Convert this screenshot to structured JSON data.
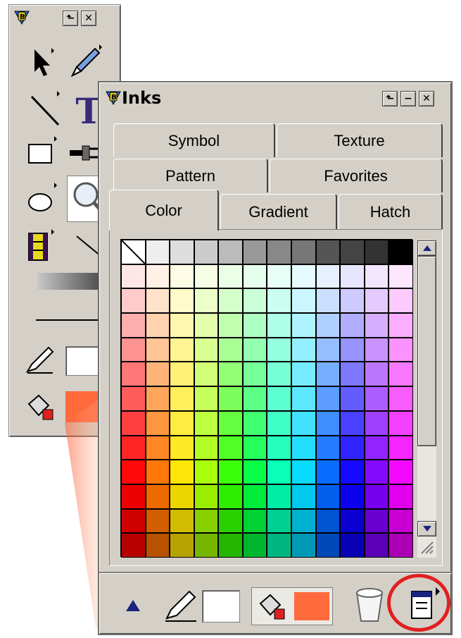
{
  "inks_panel": {
    "title": "Inks",
    "tabs_row1": [
      "Symbol",
      "Texture"
    ],
    "tabs_row2": [
      "Pattern",
      "Favorites"
    ],
    "tabs_row3": [
      "Color",
      "Gradient",
      "Hatch"
    ],
    "active_tab": "Color",
    "title_buttons": [
      "dock-icon",
      "minimize-icon",
      "close-icon"
    ],
    "stroke_color": "#ffffff",
    "fill_color": "#ff6a3d",
    "bottom_icons": [
      "collapse-triangle-icon",
      "pen-stroke-icon",
      "paint-bucket-fill-icon",
      "trash-icon",
      "panel-menu-icon"
    ]
  },
  "toolbox": {
    "title_buttons": [
      "dock-icon",
      "close-icon"
    ],
    "tools": [
      "arrow-tool-icon",
      "pen-tool-icon",
      "line-tool-icon",
      "text-tool-icon",
      "rectangle-tool-icon",
      "plug-tool-icon",
      "ellipse-tool-icon",
      "magnifier-tool-icon",
      "film-tool-icon",
      "gradient-bar-icon",
      "line-style-icon",
      "pen-stroke-icon",
      "paint-bucket-fill-icon"
    ],
    "fill_color": "#ff6a3d"
  },
  "colors": {
    "accent_highlight": "#e02020",
    "panel_bg": "#d4d0c8",
    "title_blue": "#1a237e"
  }
}
